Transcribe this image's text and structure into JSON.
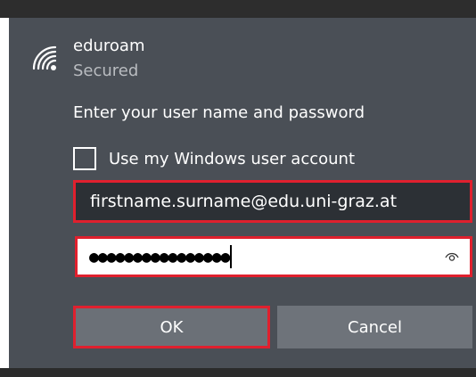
{
  "network": {
    "name": "eduroam",
    "status": "Secured",
    "icon": "wifi-secured-icon"
  },
  "dialog": {
    "prompt": "Enter your user name and password",
    "use_windows_account_label": "Use my Windows user account",
    "use_windows_account_checked": false,
    "username_value": "firstname.surname@edu.uni-graz.at",
    "password_value": "●●●●●●●●●●●●●●●●",
    "ok_label": "OK",
    "cancel_label": "Cancel"
  },
  "colors": {
    "panel_background": "#4a4f56",
    "highlight_border": "#e0202e",
    "button_background": "#6b7077"
  }
}
